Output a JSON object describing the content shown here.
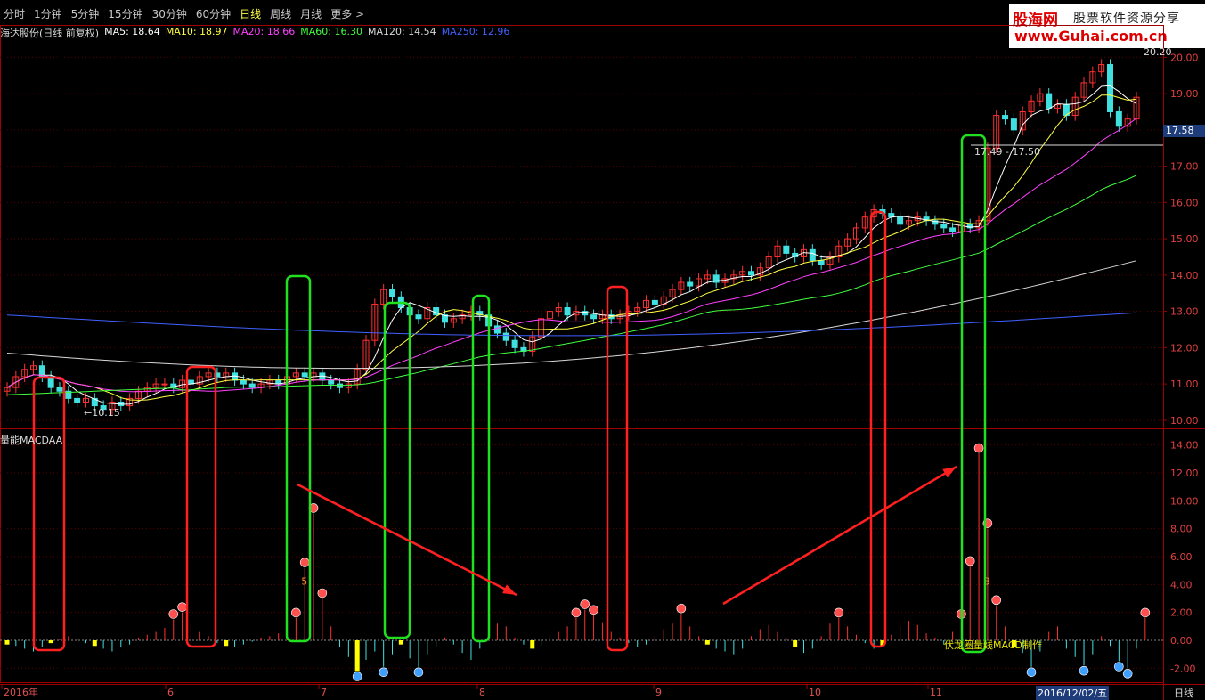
{
  "toolbar": {
    "tabs": [
      "分时",
      "1分钟",
      "5分钟",
      "15分钟",
      "30分钟",
      "60分钟",
      "日线",
      "周线",
      "月线",
      "更多 >"
    ],
    "active": "日线"
  },
  "watermark": {
    "brand": "股海网",
    "slogan": "股票软件资源分享",
    "url": "www.Guhai.com.cn"
  },
  "legend": [
    {
      "text": "海达股份(日线 前复权)",
      "color": "#d8d8d8"
    },
    {
      "text": "MA5: 18.64",
      "color": "#ffffff"
    },
    {
      "text": "MA10: 18.97",
      "color": "#ffff40"
    },
    {
      "text": "MA20: 18.66",
      "color": "#ff40ff"
    },
    {
      "text": "MA60: 16.30",
      "color": "#40ff40"
    },
    {
      "text": "MA120: 14.54",
      "color": "#d8d8d8"
    },
    {
      "text": "MA250: 12.96",
      "color": "#4060ff"
    }
  ],
  "sub_panel_title": "量能MACDAA",
  "current_price_tag": "17.58",
  "date_box": "2016/12/02/五",
  "period_label": "日线",
  "credit_text": "伏龙圈量线MACD制作",
  "annotations": {
    "min_label": "←10.15",
    "range_label": "17.49 - 17.50",
    "top_label": "20.20"
  },
  "chart_data": [
    {
      "type": "candlestick",
      "title": "海达股份(日线 前复权)",
      "ylim": [
        9.8,
        20.5
      ],
      "y_ticks": [
        "20.00",
        "19.00",
        "18.00",
        "17.00",
        "16.00",
        "15.00",
        "14.00",
        "13.00",
        "12.00",
        "11.00",
        "10.00"
      ],
      "x_tick_labels": [
        "2016年",
        "6",
        "7",
        "8",
        "9",
        "10",
        "11"
      ],
      "close": [
        10.9,
        11.2,
        11.4,
        11.5,
        11.2,
        10.9,
        10.8,
        10.6,
        10.5,
        10.6,
        10.4,
        10.3,
        10.5,
        10.4,
        10.6,
        10.8,
        10.9,
        11.0,
        11.0,
        10.9,
        11.1,
        11.0,
        11.2,
        11.3,
        11.2,
        11.3,
        11.1,
        11.0,
        10.9,
        11.0,
        11.1,
        11.0,
        11.2,
        11.3,
        11.2,
        11.3,
        11.1,
        11.0,
        10.9,
        11.0,
        11.4,
        12.2,
        13.2,
        13.6,
        13.4,
        13.1,
        12.9,
        12.8,
        13.1,
        12.9,
        12.7,
        12.8,
        12.9,
        13.0,
        12.9,
        12.6,
        12.4,
        12.2,
        12.0,
        11.9,
        12.3,
        12.8,
        13.0,
        13.1,
        12.9,
        13.0,
        12.9,
        12.8,
        12.9,
        12.8,
        12.9,
        13.0,
        13.1,
        13.3,
        13.2,
        13.4,
        13.6,
        13.8,
        13.7,
        13.9,
        14.0,
        13.8,
        13.9,
        14.0,
        14.1,
        14.0,
        14.2,
        14.5,
        14.8,
        14.6,
        14.5,
        14.7,
        14.4,
        14.3,
        14.5,
        14.8,
        15.0,
        15.3,
        15.6,
        15.8,
        15.7,
        15.6,
        15.4,
        15.5,
        15.6,
        15.5,
        15.4,
        15.3,
        15.2,
        15.4,
        15.3,
        15.5,
        17.5,
        18.4,
        18.3,
        18.0,
        18.5,
        18.8,
        19.0,
        18.6,
        18.7,
        18.4,
        18.9,
        19.3,
        19.6,
        19.8,
        18.5,
        18.1,
        18.3,
        18.9
      ],
      "ma_series": [
        {
          "name": "MA5",
          "color": "#ffffff",
          "end": 18.64
        },
        {
          "name": "MA10",
          "color": "#ffff40",
          "end": 18.97
        },
        {
          "name": "MA20",
          "color": "#ff40ff",
          "end": 18.66
        },
        {
          "name": "MA60",
          "color": "#40ff40",
          "end": 16.3
        },
        {
          "name": "MA120",
          "color": "#d8d8d8",
          "end": 14.54
        },
        {
          "name": "MA250",
          "color": "#4060ff",
          "end": 12.96
        }
      ],
      "ma250_start": 12.9,
      "ma120_start": 11.85,
      "ma60_start": 10.7,
      "hline": 17.58
    },
    {
      "type": "bar",
      "title": "量能MACDAA",
      "ylim": [
        -3.0,
        15.0
      ],
      "y_ticks": [
        "14.00",
        "12.00",
        "10.00",
        "8.00",
        "6.00",
        "4.00",
        "2.00",
        "0.00",
        "-2.00"
      ],
      "values": [
        -0.3,
        -0.4,
        -0.6,
        -0.8,
        -0.5,
        -0.2,
        0.1,
        0.3,
        0.2,
        -0.2,
        -0.4,
        -0.6,
        -0.8,
        -0.5,
        -0.3,
        0.2,
        0.4,
        0.6,
        0.9,
        1.5,
        2.0,
        1.2,
        0.6,
        0.3,
        -0.2,
        -0.4,
        -0.5,
        -0.3,
        -0.1,
        0.2,
        0.3,
        0.5,
        0.8,
        1.6,
        5.2,
        9.1,
        3.0,
        1.0,
        -0.5,
        -1.2,
        -2.2,
        -1.4,
        -0.8,
        -1.9,
        -1.0,
        -0.3,
        -1.3,
        -1.9,
        -1.0,
        -0.5,
        0.2,
        -0.3,
        -0.9,
        -1.4,
        -0.6,
        0.3,
        1.2,
        1.0,
        0.2,
        -0.3,
        -0.6,
        -0.4,
        0.4,
        0.6,
        1.0,
        1.6,
        2.2,
        1.8,
        1.3,
        0.6,
        0.2,
        -0.2,
        -0.5,
        -0.3,
        0.3,
        0.8,
        1.2,
        1.9,
        1.0,
        0.3,
        -0.3,
        -0.6,
        -0.8,
        -1.0,
        -0.6,
        0.3,
        0.8,
        1.1,
        0.6,
        0.2,
        -0.5,
        -0.9,
        -0.6,
        0.3,
        1.2,
        1.6,
        1.0,
        0.4,
        -0.2,
        -0.6,
        -0.4,
        0.4,
        1.0,
        1.4,
        1.1,
        0.5,
        0.2,
        -0.3,
        0.6,
        1.5,
        5.3,
        13.4,
        8.0,
        2.5,
        1.0,
        -0.5,
        -0.9,
        -1.9,
        -0.8,
        0.6,
        1.0,
        -0.6,
        -1.2,
        -1.8,
        -1.0,
        0.3,
        -0.4,
        -1.5,
        -2.0,
        -0.6,
        1.6
      ],
      "markers": [
        {
          "index": 34,
          "label": "5"
        },
        {
          "index": 112,
          "label": "3"
        }
      ]
    }
  ]
}
